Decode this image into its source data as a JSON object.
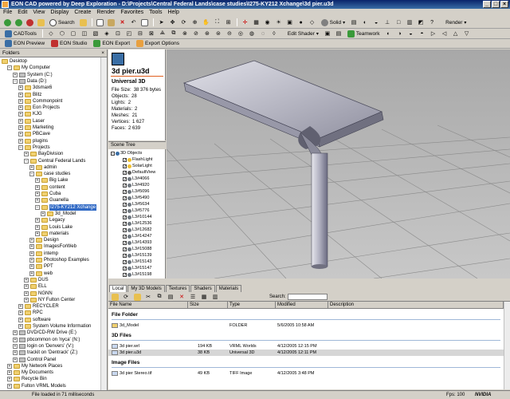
{
  "window": {
    "title": "EON CAD powered by Deep Exploration - D:\\Projects\\Central Federal Lands\\case studies\\I275-KY212 Xchange\\3d pier.u3d"
  },
  "menu": [
    "File",
    "Edit",
    "View",
    "Display",
    "Create",
    "Render",
    "Favorites",
    "Tools",
    "Help"
  ],
  "toolbar1": {
    "search_label": "Search",
    "solid_label": "Solid",
    "render_label": "Render"
  },
  "toolbar2": {
    "cadtools_label": "CADTools",
    "edit_shader_label": "Edit Shader",
    "teamwork_label": "Teamwork"
  },
  "toolbar3": {
    "eon_preview": "EON Preview",
    "eon_studio": "EON Studio",
    "eon_export": "EON Export",
    "export_options": "Export Options"
  },
  "folders": {
    "header": "Folders",
    "items": [
      {
        "label": "Desktop",
        "level": 0
      },
      {
        "label": "My Computer",
        "level": 1
      },
      {
        "label": "System (C:)",
        "level": 2
      },
      {
        "label": "Data (D:)",
        "level": 2
      },
      {
        "label": "3dsmax6",
        "level": 3
      },
      {
        "label": "Blitz",
        "level": 3
      },
      {
        "label": "Commonpoint",
        "level": 3
      },
      {
        "label": "Eon Projects",
        "level": 3
      },
      {
        "label": "KJG",
        "level": 3
      },
      {
        "label": "Laser",
        "level": 3
      },
      {
        "label": "Marketing",
        "level": 3
      },
      {
        "label": "PBCave",
        "level": 3
      },
      {
        "label": "plugins",
        "level": 3
      },
      {
        "label": "Projects",
        "level": 3
      },
      {
        "label": "BayDivision",
        "level": 4
      },
      {
        "label": "Central Federal Lands",
        "level": 4
      },
      {
        "label": "admin",
        "level": 5
      },
      {
        "label": "case studies",
        "level": 5
      },
      {
        "label": "Big Lake",
        "level": 6
      },
      {
        "label": "content",
        "level": 6
      },
      {
        "label": "Cuba",
        "level": 6
      },
      {
        "label": "Guanella",
        "level": 6
      },
      {
        "label": "I275-KY212 Xchange",
        "level": 6,
        "selected": true
      },
      {
        "label": "3d_Model",
        "level": 7
      },
      {
        "label": "Legacy",
        "level": 6
      },
      {
        "label": "Louis Lake",
        "level": 6
      },
      {
        "label": "materials",
        "level": 6
      },
      {
        "label": "Design",
        "level": 5
      },
      {
        "label": "ImagesForWeb",
        "level": 5
      },
      {
        "label": "intemp",
        "level": 5
      },
      {
        "label": "Photoshop Examples",
        "level": 5
      },
      {
        "label": "PPT",
        "level": 5
      },
      {
        "label": "web",
        "level": 5
      },
      {
        "label": "DUS",
        "level": 4
      },
      {
        "label": "ELL",
        "level": 4
      },
      {
        "label": "NGNN",
        "level": 4
      },
      {
        "label": "NY Fulton Center",
        "level": 4
      },
      {
        "label": "RECYCLER",
        "level": 3
      },
      {
        "label": "RPC",
        "level": 3
      },
      {
        "label": "software",
        "level": 3
      },
      {
        "label": "System Volume Information",
        "level": 3
      },
      {
        "label": "DVD/CD-RW Drive (E:)",
        "level": 2
      },
      {
        "label": "pbcommon on 'nyca' (N:)",
        "level": 2
      },
      {
        "label": "login on 'Denvers' (V:)",
        "level": 2
      },
      {
        "label": "trackit on 'Dentrack' (Z:)",
        "level": 2
      },
      {
        "label": "Control Panel",
        "level": 2
      },
      {
        "label": "My Network Places",
        "level": 1
      },
      {
        "label": "My Documents",
        "level": 1
      },
      {
        "label": "Recycle Bin",
        "level": 1
      },
      {
        "label": "Fulton VRML Models",
        "level": 1
      }
    ]
  },
  "preview": {
    "filename": "3d pier.u3d",
    "type": "Universal 3D",
    "rows": [
      {
        "k": "File Size:",
        "v": "38 376 bytes"
      },
      {
        "k": "Objects:",
        "v": "28"
      },
      {
        "k": "Lights:",
        "v": "2"
      },
      {
        "k": "Materials:",
        "v": "2"
      },
      {
        "k": "Meshes:",
        "v": "21"
      },
      {
        "k": "Vertices:",
        "v": "1 627"
      },
      {
        "k": "Faces:",
        "v": "2 639"
      }
    ]
  },
  "scene_tree": {
    "tab": "Scene Tree",
    "root": "3D Objects",
    "items": [
      "FlashLight",
      "SolarLight",
      "DefaultView",
      "L3#4066",
      "L3#4920",
      "L3#5096",
      "L3#5490",
      "L3#5634",
      "L3#5776",
      "L3#10144",
      "L3#12536",
      "L3#12682",
      "L3#14247",
      "L3#14393",
      "L3#15088",
      "L3#15139",
      "L3#15143",
      "L3#15147",
      "L3#15198"
    ]
  },
  "bottom_tabs": [
    "Local",
    "My 3D Models",
    "Textures",
    "Shaders",
    "Materials"
  ],
  "file_toolbar": {
    "search_label": "Search:",
    "search_value": ""
  },
  "file_list": {
    "columns": [
      "File Name",
      "Size",
      "Type",
      "Modified",
      "Description"
    ],
    "groups": [
      {
        "name": "File Folder",
        "rows": [
          {
            "name": "3d_Model",
            "size": "",
            "type": "FOLDER",
            "modified": "5/6/2005 10:58 AM",
            "desc": ""
          }
        ]
      },
      {
        "name": "3D Files",
        "rows": [
          {
            "name": "3d pier.wrl",
            "size": "194 KB",
            "type": "VRML Worlds",
            "modified": "4/12/2005 12:15 PM",
            "desc": ""
          },
          {
            "name": "3d pier.u3d",
            "size": "38 KB",
            "type": "Universal 3D",
            "modified": "4/12/2005 12:11 PM",
            "desc": "",
            "selected": true
          }
        ]
      },
      {
        "name": "Image Files",
        "rows": [
          {
            "name": "3d pier Stereo.tif",
            "size": "49 KB",
            "type": "TIFF Image",
            "modified": "4/12/2005 3:48 PM",
            "desc": ""
          }
        ]
      }
    ]
  },
  "status": {
    "text": "File loaded in 71 milliseconds",
    "fps": "Fps: 100",
    "gpu": "NVIDIA"
  }
}
